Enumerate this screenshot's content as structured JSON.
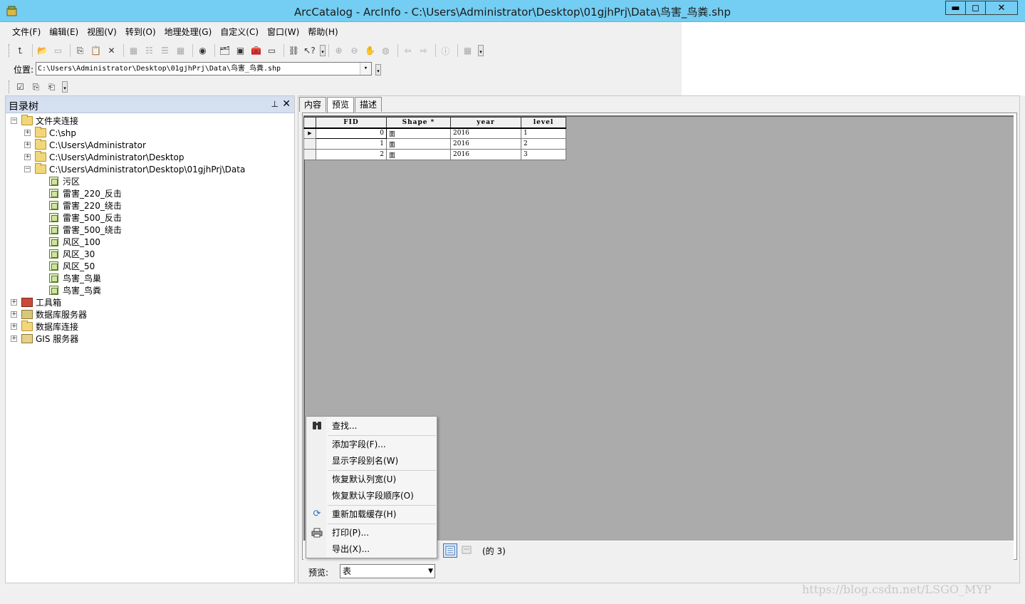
{
  "window": {
    "title": "ArcCatalog - ArcInfo - C:\\Users\\Administrator\\Desktop\\01gjhPrj\\Data\\鸟害_鸟粪.shp",
    "minimize": "▬",
    "maximize": "◻",
    "close": "✕"
  },
  "menu": [
    "文件(F)",
    "编辑(E)",
    "视图(V)",
    "转到(O)",
    "地理处理(G)",
    "自定义(C)",
    "窗口(W)",
    "帮助(H)"
  ],
  "location": {
    "label": "位置:",
    "value": "C:\\Users\\Administrator\\Desktop\\01gjhPrj\\Data\\鸟害_鸟粪.shp"
  },
  "tree": {
    "title": "目录树",
    "root": "文件夹连接",
    "folders": [
      "C:\\shp",
      "C:\\Users\\Administrator",
      "C:\\Users\\Administrator\\Desktop",
      "C:\\Users\\Administrator\\Desktop\\01gjhPrj\\Data"
    ],
    "files": [
      "污区",
      "雷害_220_反击",
      "雷害_220_绕击",
      "雷害_500_反击",
      "雷害_500_绕击",
      "风区_100",
      "风区_30",
      "风区_50",
      "鸟害_鸟巢",
      "鸟害_鸟粪"
    ],
    "others": [
      "工具箱",
      "数据库服务器",
      "数据库连接",
      "GIS 服务器"
    ]
  },
  "tabs": [
    "内容",
    "预览",
    "描述"
  ],
  "table": {
    "headers": [
      "FID",
      "Shape *",
      "year",
      "level"
    ],
    "rows": [
      {
        "fid": "0",
        "shape": "面",
        "year": "2016",
        "level": "1"
      },
      {
        "fid": "1",
        "shape": "面",
        "year": "2016",
        "level": "2"
      },
      {
        "fid": "2",
        "shape": "面",
        "year": "2016",
        "level": "3"
      }
    ]
  },
  "status": {
    "count": "(的 3)"
  },
  "preview": {
    "label": "预览:",
    "value": "表"
  },
  "context_menu": {
    "find": "查找...",
    "add_field": "添加字段(F)...",
    "show_alias": "显示字段别名(W)",
    "restore_width": "恢复默认列宽(U)",
    "restore_order": "恢复默认字段顺序(O)",
    "reload_cache": "重新加载缓存(H)",
    "print": "打印(P)...",
    "export": "导出(X)..."
  },
  "watermark": "https://blog.csdn.net/LSGO_MYP"
}
